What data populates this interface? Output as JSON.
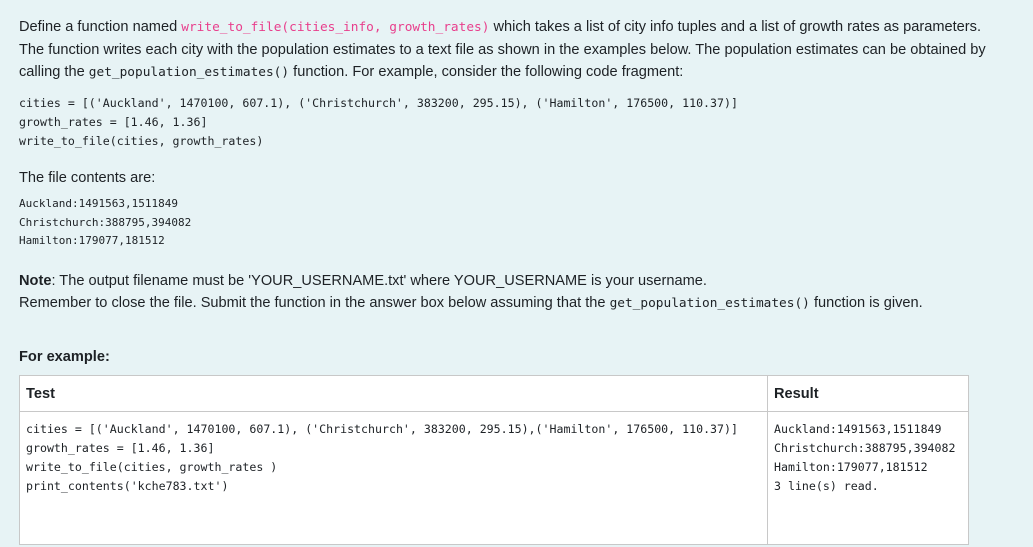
{
  "question": {
    "p1_prefix": "Define a function named ",
    "p1_function_sig": "write_to_file(cities_info, growth_rates)",
    "p1_after_sig": " which takes a list of city info tuples and a list of growth rates as parameters.",
    "p1_line2": "The function writes each city with the population estimates to a text file as shown in the examples below. The population estimates can be obtained by",
    "p1_line3_prefix": "calling the ",
    "p1_line3_code": "get_population_estimates()",
    "p1_line3_suffix": " function. For example, consider the following code fragment:",
    "code_fragment": [
      "cities = [('Auckland', 1470100, 607.1), ('Christchurch', 383200, 295.15), ('Hamilton', 176500, 110.37)]",
      "growth_rates = [1.46, 1.36]",
      "write_to_file(cities, growth_rates)"
    ],
    "file_contents_label": "The file contents are:",
    "file_contents": [
      "Auckland:1491563,1511849",
      "Christchurch:388795,394082",
      "Hamilton:179077,181512"
    ],
    "note_label": "Note",
    "note_text": ": The output filename must be 'YOUR_USERNAME.txt' where YOUR_USERNAME is your username.",
    "remember_prefix": "Remember to close the file. Submit the function in the answer box below assuming that the ",
    "remember_code": "get_population_estimates()",
    "remember_suffix": " function is given."
  },
  "example": {
    "heading": "For example:",
    "columns": [
      "Test",
      "Result"
    ],
    "test_lines": [
      "cities = [('Auckland', 1470100, 607.1), ('Christchurch', 383200, 295.15),('Hamilton', 176500, 110.37)]",
      "growth_rates = [1.46, 1.36]",
      "write_to_file(cities, growth_rates )",
      "print_contents('kche783.txt')"
    ],
    "result_lines": [
      "Auckland:1491563,1511849",
      "Christchurch:388795,394082",
      "Hamilton:179077,181512",
      "3 line(s) read."
    ]
  }
}
